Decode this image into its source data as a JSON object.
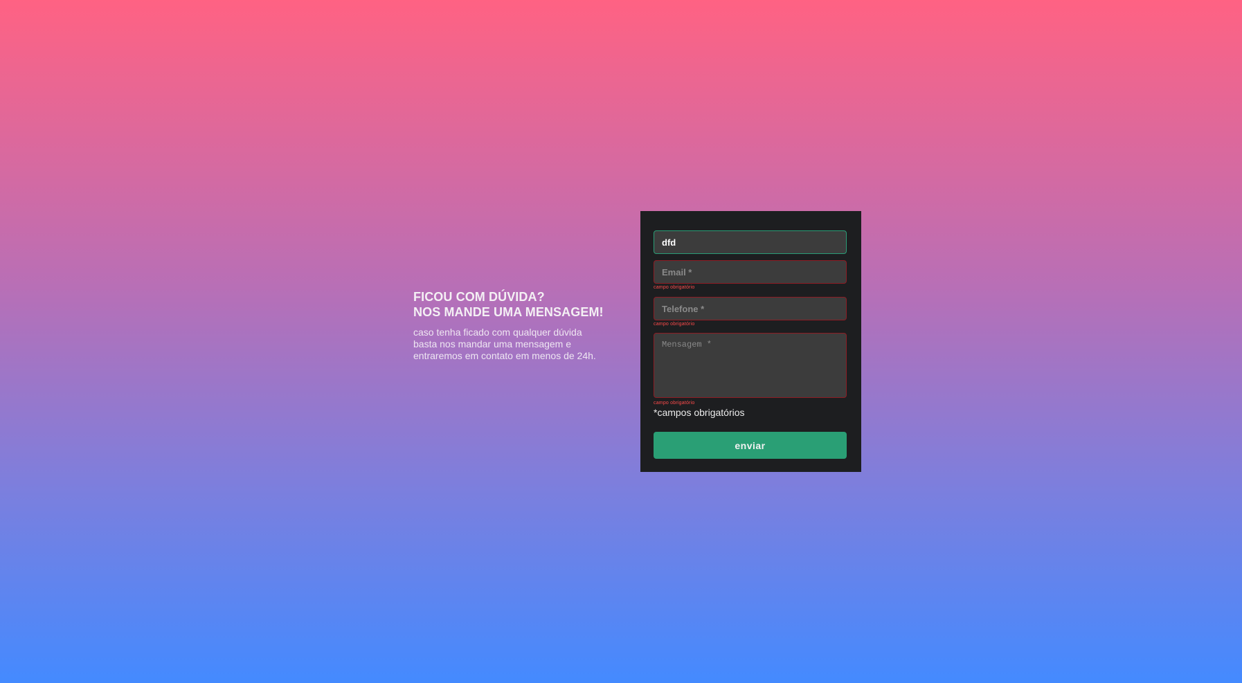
{
  "intro": {
    "heading_line1": "FICOU COM DÚVIDA?",
    "heading_line2": "NOS MANDE UMA MENSAGEM!",
    "text_line1": "caso tenha ficado com qualquer dúvida",
    "text_line2": "basta nos mandar uma mensagem e",
    "text_line3": "entraremos em contato em menos de 24h."
  },
  "form": {
    "name_value": "dfd",
    "email_placeholder": "Email *",
    "phone_placeholder": "Telefone *",
    "message_placeholder": "Mensagem *",
    "email_error": "campo obrigatório",
    "phone_error": "campo obrigatório",
    "message_error": "campo obrigatório",
    "required_note": "*campos obrigatórios",
    "submit_label": "enviar"
  },
  "colors": {
    "card_background": "#1d1e20",
    "field_background": "#3c3c3c",
    "error_border": "#8e1c24",
    "valid_border": "#2a9e77",
    "error_text": "#ff4b4b",
    "button": "#2a9f75",
    "gradient_top": "#ff6283",
    "gradient_bottom": "#448aff"
  }
}
